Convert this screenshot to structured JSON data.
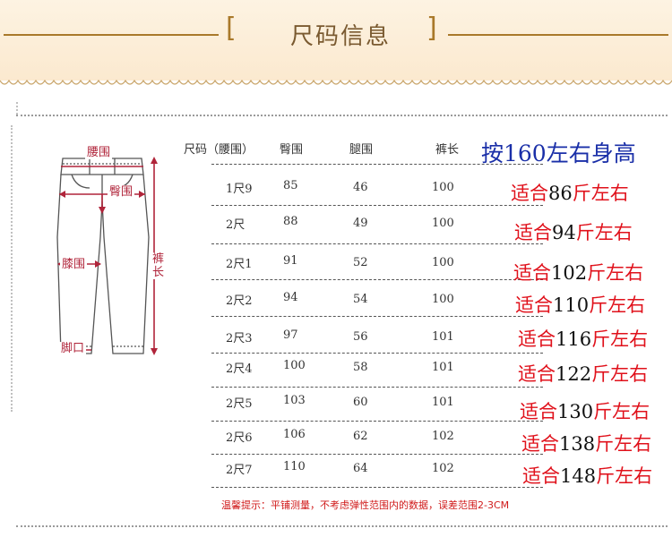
{
  "header": {
    "title": "尺码信息",
    "bracket_left": "[",
    "bracket_right": "]"
  },
  "diagram": {
    "labels": {
      "waist": "腰围",
      "hip": "臀围",
      "knee": "膝围",
      "length": "裤长",
      "hem": "脚口"
    }
  },
  "table": {
    "headers": [
      "尺码（腰围）",
      "臀围",
      "腿围",
      "裤长"
    ],
    "height_note": "按160左右身高",
    "fit_prefix": "适合",
    "fit_suffix": "斤左右",
    "rows": [
      {
        "size": "1尺9",
        "hip": "85",
        "thigh": "46",
        "length": "100",
        "weight": "86"
      },
      {
        "size": "2尺",
        "hip": "88",
        "thigh": "49",
        "length": "100",
        "weight": "94"
      },
      {
        "size": "2尺1",
        "hip": "91",
        "thigh": "52",
        "length": "100",
        "weight": "102"
      },
      {
        "size": "2尺2",
        "hip": "94",
        "thigh": "54",
        "length": "100",
        "weight": "110"
      },
      {
        "size": "2尺3",
        "hip": "97",
        "thigh": "56",
        "length": "101",
        "weight": "116"
      },
      {
        "size": "2尺4",
        "hip": "100",
        "thigh": "58",
        "length": "101",
        "weight": "122"
      },
      {
        "size": "2尺5",
        "hip": "103",
        "thigh": "60",
        "length": "101",
        "weight": "130"
      },
      {
        "size": "2尺6",
        "hip": "106",
        "thigh": "62",
        "length": "102",
        "weight": "138"
      },
      {
        "size": "2尺7",
        "hip": "110",
        "thigh": "64",
        "length": "102",
        "weight": "148"
      }
    ]
  },
  "tip": "温馨提示：平铺测量，不考虑弹性范围内的数据，误差范围2-3CM",
  "colors": {
    "gold": "#a9792a",
    "red": "#e0111b",
    "blue": "#1a2fa8",
    "label_red": "#b0243a"
  }
}
